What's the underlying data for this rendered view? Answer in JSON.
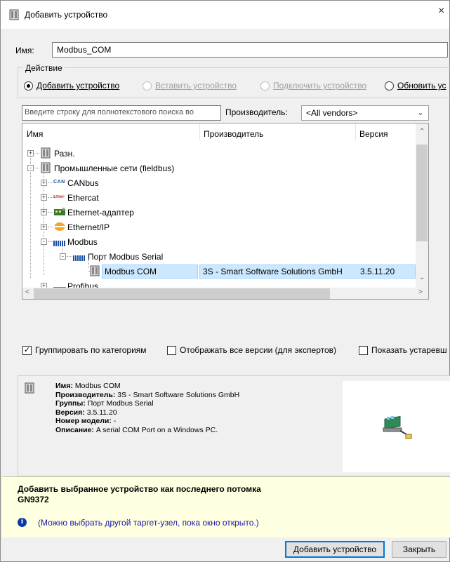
{
  "window": {
    "title": "Добавить устройство",
    "close_glyph": "×"
  },
  "name_field": {
    "label": "Имя:",
    "value": "Modbus_COM"
  },
  "action_group": {
    "title": "Действие",
    "options": [
      {
        "label": "Добавить устройство",
        "checked": true,
        "enabled": true
      },
      {
        "label": "Вставить устройство",
        "checked": false,
        "enabled": false
      },
      {
        "label": "Подключить устройство",
        "checked": false,
        "enabled": false
      },
      {
        "label": "Обновить ус",
        "checked": false,
        "enabled": true
      }
    ]
  },
  "search": {
    "placeholder": "Введите строку для полнотекстового поиска во",
    "vendor_label": "Производитель:",
    "vendor_value": "<All vendors>"
  },
  "tree": {
    "columns": [
      "Имя",
      "Производитель",
      "Версия"
    ],
    "rows": [
      {
        "name": "Разн.",
        "vendor": "",
        "version": "",
        "icon": "device-folder-icon",
        "expander": "+"
      },
      {
        "name": "Промышленные сети (fieldbus)",
        "vendor": "",
        "version": "",
        "icon": "device-folder-icon",
        "expander": "-"
      },
      {
        "name": "CANbus",
        "vendor": "",
        "version": "",
        "icon": "can-icon",
        "icon_text": "CAN",
        "expander": "+"
      },
      {
        "name": "Ethercat",
        "vendor": "",
        "version": "",
        "icon": "ethercat-icon",
        "icon_text": "EtherCAT",
        "expander": "+"
      },
      {
        "name": "Ethernet-адаптер",
        "vendor": "",
        "version": "",
        "icon": "ethernet-adapter-icon",
        "expander": "+"
      },
      {
        "name": "Ethernet/IP",
        "vendor": "",
        "version": "",
        "icon": "ethernet-ip-icon",
        "expander": "+"
      },
      {
        "name": "Modbus",
        "vendor": "",
        "version": "",
        "icon": "modbus-icon",
        "expander": "-"
      },
      {
        "name": "Порт Modbus Serial",
        "vendor": "",
        "version": "",
        "icon": "modbus-icon",
        "expander": "-"
      },
      {
        "name": "Modbus COM",
        "vendor": "3S - Smart Software Solutions GmbH",
        "version": "3.5.11.20",
        "icon": "device-icon",
        "selected": true
      },
      {
        "name": "Profibus",
        "vendor": "",
        "version": "",
        "icon": "profibus-icon",
        "expander": "+"
      }
    ]
  },
  "options": {
    "group_by_category": {
      "label": "Группировать по категориям",
      "checked": true
    },
    "show_all_versions": {
      "label": "Отображать все версии (для экспертов)",
      "checked": false
    },
    "show_outdated": {
      "label": "Показать устаревш",
      "checked": false
    }
  },
  "info": {
    "name_label": "Имя:",
    "name_value": "Modbus COM",
    "vendor_label": "Производитель:",
    "vendor_value": "3S - Smart Software Solutions GmbH",
    "groups_label": "Группы:",
    "groups_value": "Порт Modbus Serial",
    "version_label": "Версия:",
    "version_value": "3.5.11.20",
    "model_label": "Номер модели:",
    "model_value": "-",
    "description_label": "Описание:",
    "description_value": "A serial COM Port on a Windows PC."
  },
  "footer": {
    "append_title": "Добавить выбранное устройство как последнего потомка",
    "target_node": "GN9372",
    "hint": "(Можно выбрать другой таргет-узел, пока окно открыто.)"
  },
  "buttons": {
    "add": "Добавить устройство",
    "close": "Закрыть"
  },
  "colors": {
    "selection": "#cce8ff",
    "info_panel": "#ffffe1",
    "hint_text": "#1a1aa6",
    "default_button_border": "#0078d7"
  }
}
